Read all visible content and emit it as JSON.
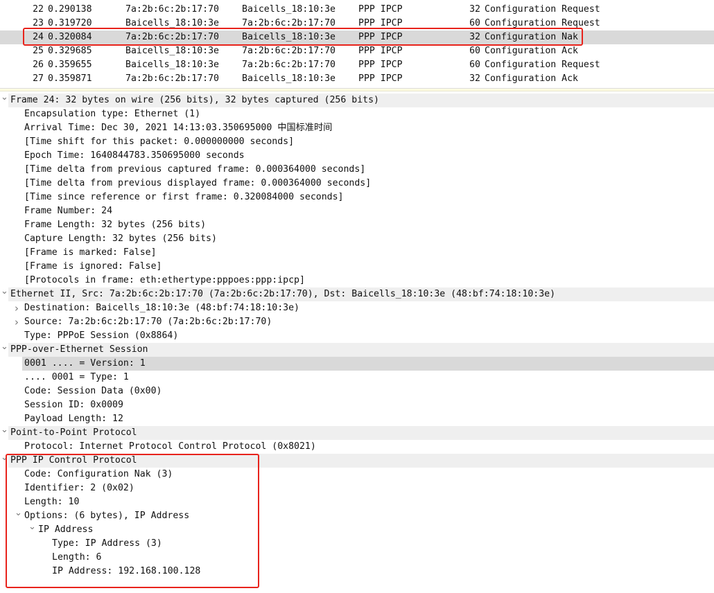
{
  "packet_list": {
    "selected_no": "24",
    "rows": [
      {
        "no": "22",
        "time": "0.290138",
        "src": "7a:2b:6c:2b:17:70",
        "dst": "Baicells_18:10:3e",
        "proto": "PPP IPCP",
        "len": "32",
        "info": "Configuration Request"
      },
      {
        "no": "23",
        "time": "0.319720",
        "src": "Baicells_18:10:3e",
        "dst": "7a:2b:6c:2b:17:70",
        "proto": "PPP IPCP",
        "len": "60",
        "info": "Configuration Request"
      },
      {
        "no": "24",
        "time": "0.320084",
        "src": "7a:2b:6c:2b:17:70",
        "dst": "Baicells_18:10:3e",
        "proto": "PPP IPCP",
        "len": "32",
        "info": "Configuration Nak"
      },
      {
        "no": "25",
        "time": "0.329685",
        "src": "Baicells_18:10:3e",
        "dst": "7a:2b:6c:2b:17:70",
        "proto": "PPP IPCP",
        "len": "60",
        "info": "Configuration Ack"
      },
      {
        "no": "26",
        "time": "0.359655",
        "src": "Baicells_18:10:3e",
        "dst": "7a:2b:6c:2b:17:70",
        "proto": "PPP IPCP",
        "len": "60",
        "info": "Configuration Request"
      },
      {
        "no": "27",
        "time": "0.359871",
        "src": "7a:2b:6c:2b:17:70",
        "dst": "Baicells_18:10:3e",
        "proto": "PPP IPCP",
        "len": "32",
        "info": "Configuration Ack"
      }
    ]
  },
  "packet_details": [
    {
      "level": 0,
      "expander": "open",
      "header": true,
      "text": "Frame 24: 32 bytes on wire (256 bits), 32 bytes captured (256 bits)"
    },
    {
      "level": 1,
      "text": "Encapsulation type: Ethernet (1)"
    },
    {
      "level": 1,
      "text": "Arrival Time: Dec 30, 2021 14:13:03.350695000 中国标准时间"
    },
    {
      "level": 1,
      "text": "[Time shift for this packet: 0.000000000 seconds]"
    },
    {
      "level": 1,
      "text": "Epoch Time: 1640844783.350695000 seconds"
    },
    {
      "level": 1,
      "text": "[Time delta from previous captured frame: 0.000364000 seconds]"
    },
    {
      "level": 1,
      "text": "[Time delta from previous displayed frame: 0.000364000 seconds]"
    },
    {
      "level": 1,
      "text": "[Time since reference or first frame: 0.320084000 seconds]"
    },
    {
      "level": 1,
      "text": "Frame Number: 24"
    },
    {
      "level": 1,
      "text": "Frame Length: 32 bytes (256 bits)"
    },
    {
      "level": 1,
      "text": "Capture Length: 32 bytes (256 bits)"
    },
    {
      "level": 1,
      "text": "[Frame is marked: False]"
    },
    {
      "level": 1,
      "text": "[Frame is ignored: False]"
    },
    {
      "level": 1,
      "text": "[Protocols in frame: eth:ethertype:pppoes:ppp:ipcp]"
    },
    {
      "level": 0,
      "expander": "open",
      "header": true,
      "text": "Ethernet II, Src: 7a:2b:6c:2b:17:70 (7a:2b:6c:2b:17:70), Dst: Baicells_18:10:3e (48:bf:74:18:10:3e)"
    },
    {
      "level": 1,
      "expander": "closed",
      "text": "Destination: Baicells_18:10:3e (48:bf:74:18:10:3e)"
    },
    {
      "level": 1,
      "expander": "closed",
      "text": "Source: 7a:2b:6c:2b:17:70 (7a:2b:6c:2b:17:70)"
    },
    {
      "level": 1,
      "text": "Type: PPPoE Session (0x8864)"
    },
    {
      "level": 0,
      "expander": "open",
      "header": true,
      "text": "PPP-over-Ethernet Session"
    },
    {
      "level": 1,
      "selected": true,
      "text": "0001 .... = Version: 1"
    },
    {
      "level": 1,
      "text": ".... 0001 = Type: 1"
    },
    {
      "level": 1,
      "text": "Code: Session Data (0x00)"
    },
    {
      "level": 1,
      "text": "Session ID: 0x0009"
    },
    {
      "level": 1,
      "text": "Payload Length: 12"
    },
    {
      "level": 0,
      "expander": "open",
      "header": true,
      "text": "Point-to-Point Protocol"
    },
    {
      "level": 1,
      "text": "Protocol: Internet Protocol Control Protocol (0x8021)"
    },
    {
      "level": 0,
      "expander": "open",
      "header": true,
      "text": "PPP IP Control Protocol"
    },
    {
      "level": 1,
      "text": "Code: Configuration Nak (3)"
    },
    {
      "level": 1,
      "text": "Identifier: 2 (0x02)"
    },
    {
      "level": 1,
      "text": "Length: 10"
    },
    {
      "level": 1,
      "expander": "open",
      "text": "Options: (6 bytes), IP Address"
    },
    {
      "level": 2,
      "expander": "open",
      "text": "IP Address"
    },
    {
      "level": 3,
      "text": "Type: IP Address (3)"
    },
    {
      "level": 3,
      "text": "Length: 6"
    },
    {
      "level": 3,
      "text": "IP Address: 192.168.100.128"
    }
  ],
  "colors": {
    "highlight_box": "#e8231c",
    "selected_row": "#d9d9d9",
    "header_row": "#efefef"
  }
}
